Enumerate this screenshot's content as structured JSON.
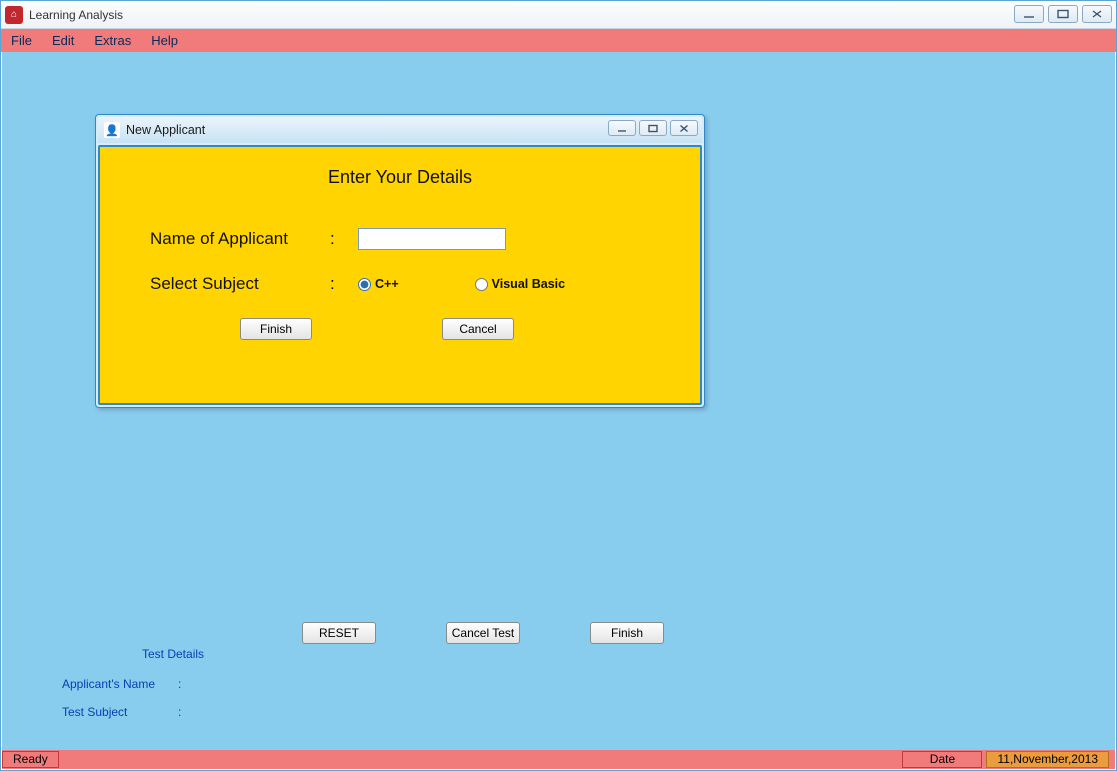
{
  "app": {
    "title": "Learning Analysis"
  },
  "menu": {
    "file": "File",
    "edit": "Edit",
    "extras": "Extras",
    "help": "Help"
  },
  "dialog": {
    "title": "New Applicant",
    "heading": "Enter Your Details",
    "name_label": "Name of Applicant",
    "name_value": "",
    "subject_label": "Select Subject",
    "subject_options": {
      "cpp": "C++",
      "vb": "Visual Basic"
    },
    "subject_selected": "cpp",
    "finish": "Finish",
    "cancel": "Cancel"
  },
  "bottom_buttons": {
    "reset": "RESET",
    "cancel_test": "Cancel Test",
    "finish": "Finish"
  },
  "test_details": {
    "title": "Test Details",
    "applicant_name_label": "Applicant's Name",
    "applicant_name_value": "",
    "test_subject_label": "Test Subject",
    "test_subject_value": ""
  },
  "status": {
    "ready": "Ready",
    "date_label": "Date",
    "date_value": "11,November,2013"
  }
}
